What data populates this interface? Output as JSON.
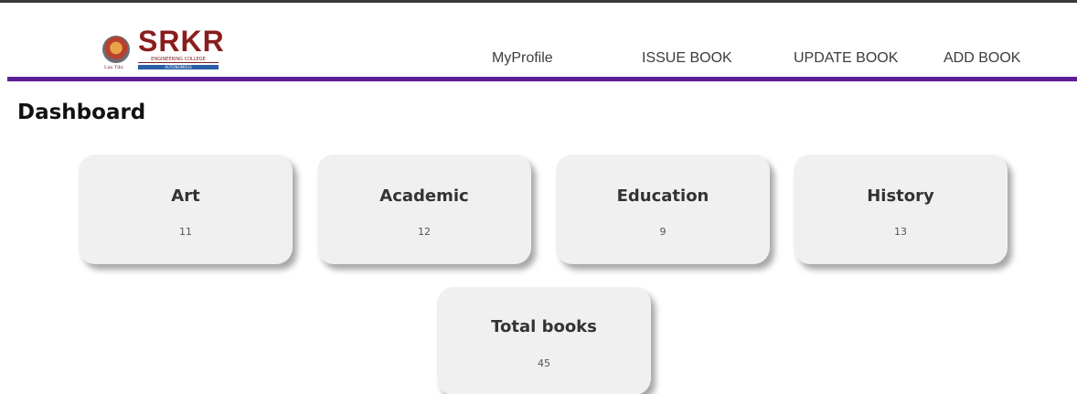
{
  "brand": {
    "name": "SRKR",
    "subtitle": "ENGINEERING COLLEGE",
    "tagline": "AUTONOMOUS",
    "seal_caption": "Lux Tibi"
  },
  "nav": {
    "items": [
      {
        "label": "MyProfile"
      },
      {
        "label": "ISSUE BOOK"
      },
      {
        "label": "UPDATE BOOK"
      },
      {
        "label": "ADD BOOK"
      }
    ]
  },
  "page": {
    "title": "Dashboard"
  },
  "categories": [
    {
      "name": "Art",
      "count": "11"
    },
    {
      "name": "Academic",
      "count": "12"
    },
    {
      "name": "Education",
      "count": "9"
    },
    {
      "name": "History",
      "count": "13"
    }
  ],
  "total": {
    "name": "Total books",
    "count": "45"
  },
  "colors": {
    "accent": "#5b1f98",
    "brand": "#8a1d1d",
    "card_bg": "#f0f0f0"
  }
}
